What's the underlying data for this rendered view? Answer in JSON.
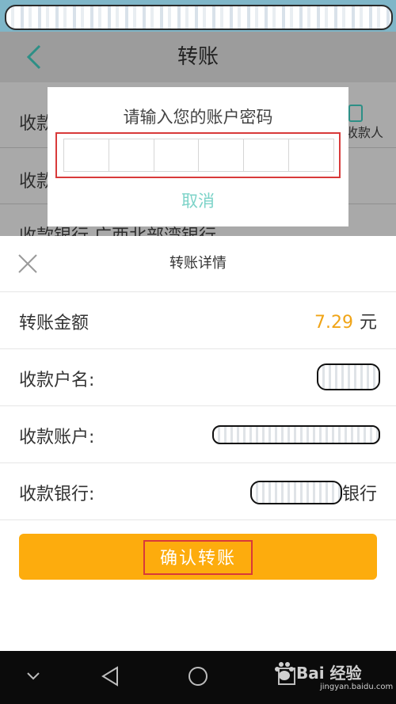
{
  "nav": {
    "title": "转账"
  },
  "background_form": {
    "row1": "收款",
    "row2": "收款",
    "row3": "收款银行 广西北部湾银行",
    "contact_label": "收款人"
  },
  "dialog": {
    "title": "请输入您的账户密码",
    "cancel_label": "取消",
    "password_cells": 6
  },
  "sheet": {
    "title": "转账详情",
    "amount_label": "转账金额",
    "amount_value": "7.29",
    "amount_unit": "元",
    "payee_name_label": "收款户名:",
    "payee_account_label": "收款账户:",
    "payee_bank_label": "收款银行:",
    "payee_bank_suffix": "银行",
    "confirm_label": "确认转账"
  },
  "watermark": {
    "brand": "Bai 经验",
    "url": "jingyan.baidu.com"
  },
  "colors": {
    "accent_teal": "#2d8f86",
    "amount": "#f0a417",
    "confirm": "#fdac0d",
    "highlight": "#d83a3a"
  }
}
